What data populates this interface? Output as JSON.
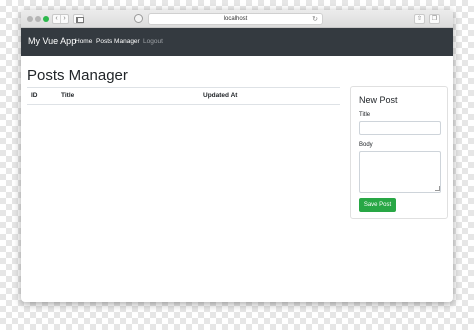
{
  "browser": {
    "address": "localhost",
    "reload_icon": "reload-icon",
    "back_icon": "chevron-left-icon",
    "forward_icon": "chevron-right-icon"
  },
  "navbar": {
    "brand": "My Vue App",
    "links": [
      {
        "label": "Home"
      },
      {
        "label": "Posts Manager"
      },
      {
        "label": "Logout"
      }
    ]
  },
  "main": {
    "title": "Posts Manager",
    "table": {
      "columns": [
        "ID",
        "Title",
        "Updated At"
      ],
      "rows": []
    }
  },
  "form": {
    "title": "New Post",
    "title_label": "Title",
    "title_value": "",
    "body_label": "Body",
    "body_value": "",
    "submit_label": "Save Post"
  },
  "colors": {
    "navbar": "#343a40",
    "submit": "#28a745",
    "traffic_green": "#2db84d"
  }
}
